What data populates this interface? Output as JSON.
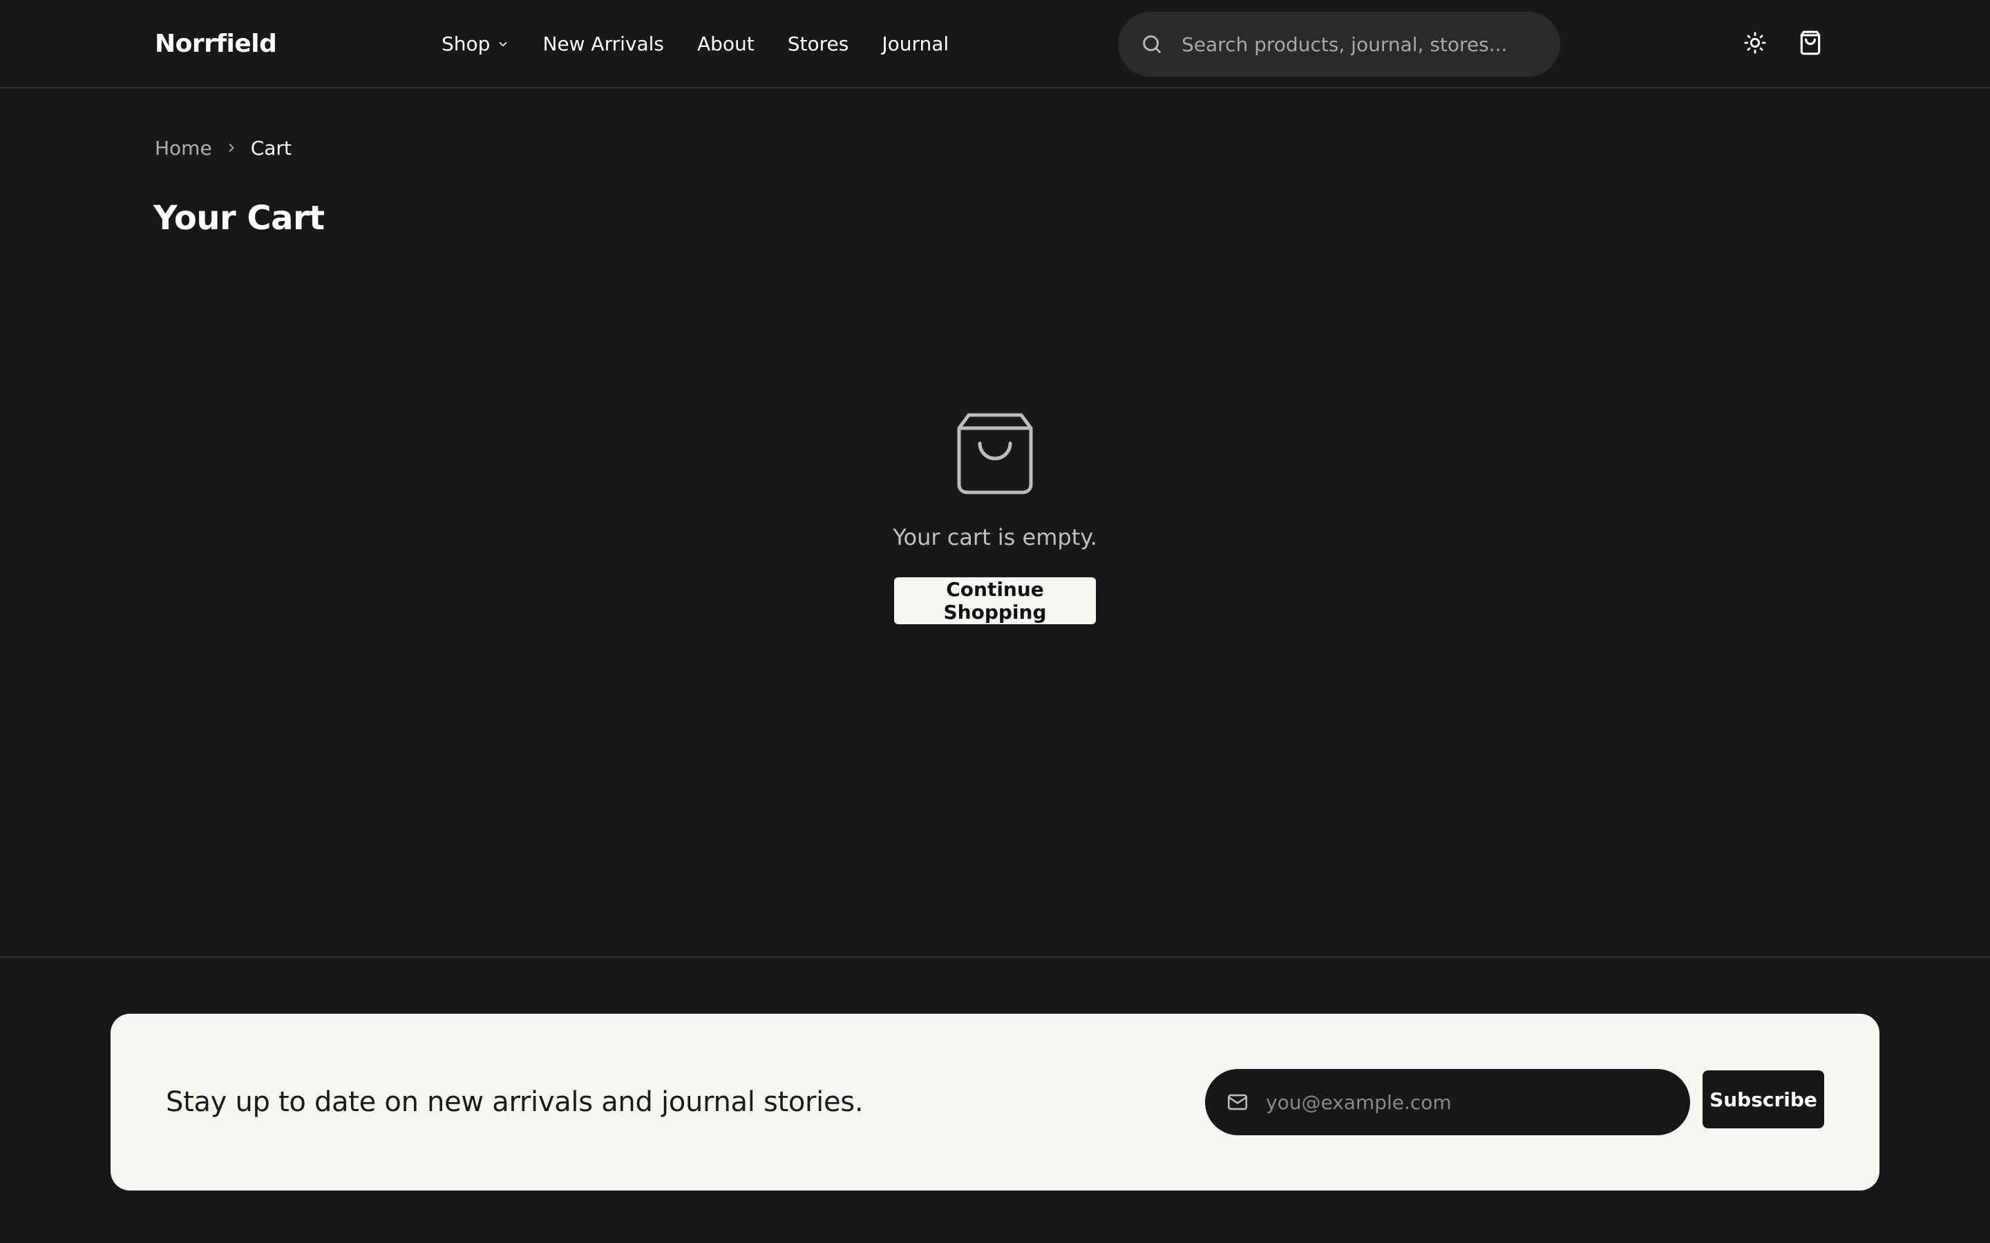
{
  "header": {
    "logo": "Norrfield",
    "nav": [
      {
        "label": "Shop"
      },
      {
        "label": "New Arrivals"
      },
      {
        "label": "About"
      },
      {
        "label": "Stores"
      },
      {
        "label": "Journal"
      }
    ],
    "search_placeholder": "Search products, journal, stores...",
    "icons": {
      "search": "search-icon",
      "theme_toggle": "sun-icon",
      "cart": "shopping-bag-icon",
      "shop_dropdown": "chevron-down-icon"
    }
  },
  "breadcrumb": {
    "home": "Home",
    "current": "Cart"
  },
  "page_title": "Your Cart",
  "empty_state": {
    "icon": "shopping-bag-icon",
    "message": "Your cart is empty.",
    "button_label": "Continue Shopping"
  },
  "newsletter": {
    "text": "Stay up to date on new arrivals and journal stories.",
    "email_placeholder": "you@example.com",
    "button_label": "Subscribe",
    "icon": "mail-icon"
  },
  "colors": {
    "background": "#181818",
    "surface": "#2a2a2a",
    "light_panel": "#f6f5f2",
    "muted_text": "#b0b0b0"
  }
}
